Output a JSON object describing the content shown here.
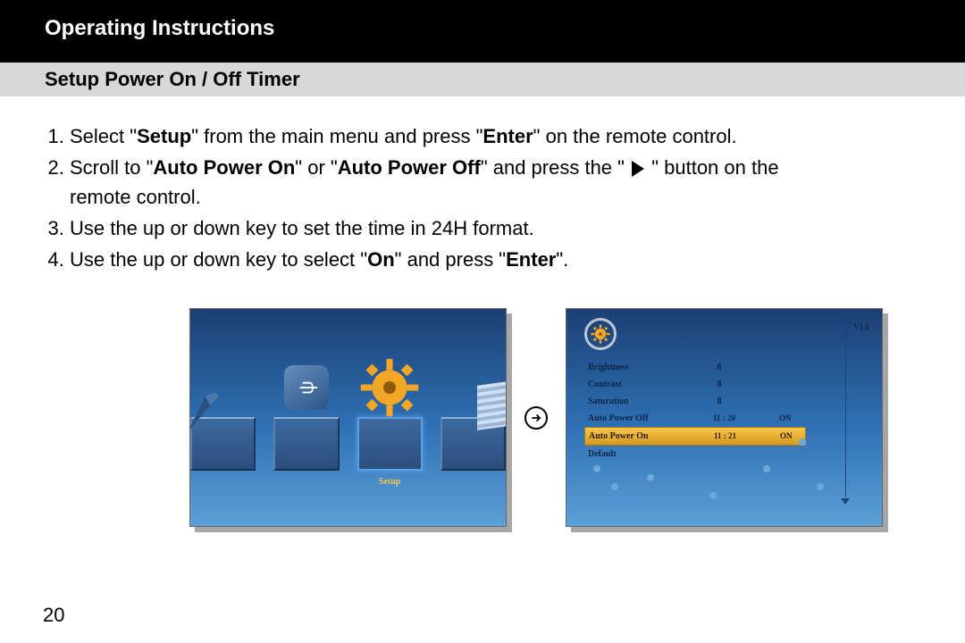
{
  "header": {
    "title": "Operating Instructions"
  },
  "section": {
    "title": "Setup Power On / Off Timer"
  },
  "steps": {
    "s1a": "Select \"",
    "s1b": "Setup",
    "s1c": "\" from the main menu and press \"",
    "s1d": "Enter",
    "s1e": "\" on the remote control.",
    "s2a": "Scroll to \"",
    "s2b": "Auto Power On",
    "s2c": "\" or \"",
    "s2d": "Auto Power Off",
    "s2e": "\"  and press the \" ",
    "s2f": " \" button on the",
    "s2g": "remote control.",
    "s3": "Use the up or down key to set the time in 24H format.",
    "s4a": "Use the up or down key to select \"",
    "s4b": "On",
    "s4c": "\" and press \"",
    "s4d": "Enter",
    "s4e": "\"."
  },
  "screen1": {
    "setup_label": "Setup"
  },
  "screen2": {
    "version": "V1.1",
    "items": {
      "brightness": {
        "label": "Brightness",
        "val": "8"
      },
      "contrast": {
        "label": "Contrast",
        "val": "8"
      },
      "saturation": {
        "label": "Saturation",
        "val": "8"
      },
      "apoff": {
        "label": "Auto Power Off",
        "time": "11 : 20",
        "state": "ON"
      },
      "apon": {
        "label": "Auto Power On",
        "time": "11 : 21",
        "state": "ON"
      },
      "default": {
        "label": "Default"
      }
    }
  },
  "page": "20"
}
